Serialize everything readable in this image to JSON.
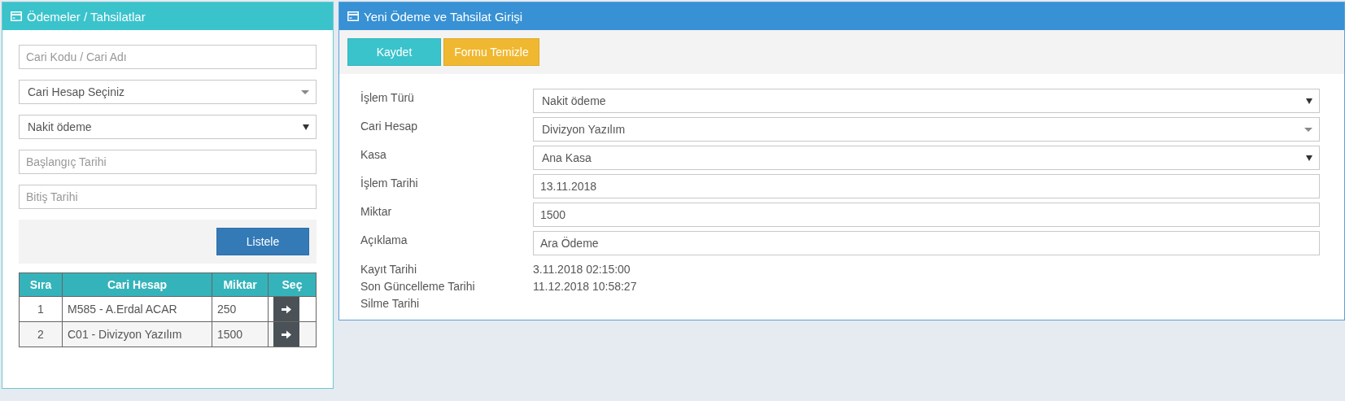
{
  "left_panel": {
    "title": "Ödemeler / Tahsilatlar",
    "filters": [
      {
        "kind": "input",
        "placeholder": "Cari Kodu / Cari Adı"
      },
      {
        "kind": "combo",
        "value": "Cari Hesap Seçiniz"
      },
      {
        "kind": "select",
        "value": "Nakit ödeme"
      },
      {
        "kind": "input",
        "placeholder": "Başlangıç Tarihi"
      },
      {
        "kind": "input",
        "placeholder": "Bitiş Tarihi"
      }
    ],
    "list_button": "Listele",
    "table": {
      "columns": [
        "Sıra",
        "Cari Hesap",
        "Miktar",
        "Seç"
      ],
      "rows": [
        {
          "no": "1",
          "account": "M585 - A.Erdal ACAR",
          "amount": "250"
        },
        {
          "no": "2",
          "account": "C01 - Divizyon Yazılım",
          "amount": "1500"
        }
      ]
    }
  },
  "right_panel": {
    "title": "Yeni Ödeme ve Tahsilat Girişi",
    "buttons": [
      {
        "kind": "primary",
        "label": "Kaydet"
      },
      {
        "kind": "warning",
        "label": "Formu Temizle"
      }
    ],
    "fields": [
      {
        "kind": "select",
        "label": "İşlem Türü",
        "value": "Nakit ödeme"
      },
      {
        "kind": "combo",
        "label": "Cari Hesap",
        "value": "Divizyon Yazılım"
      },
      {
        "kind": "select",
        "label": "Kasa",
        "value": "Ana Kasa"
      },
      {
        "kind": "input",
        "label": "İşlem Tarihi",
        "value": "13.11.2018"
      },
      {
        "kind": "input",
        "label": "Miktar",
        "value": "1500"
      },
      {
        "kind": "input",
        "label": "Açıklama",
        "value": "Ara Ödeme"
      }
    ],
    "info": [
      {
        "label": "Kayıt Tarihi",
        "value": "3.11.2018 02:15:00"
      },
      {
        "label": "Son Güncelleme Tarihi",
        "value": "11.12.2018 10:58:27"
      },
      {
        "label": "Silme Tarihi"
      }
    ]
  }
}
